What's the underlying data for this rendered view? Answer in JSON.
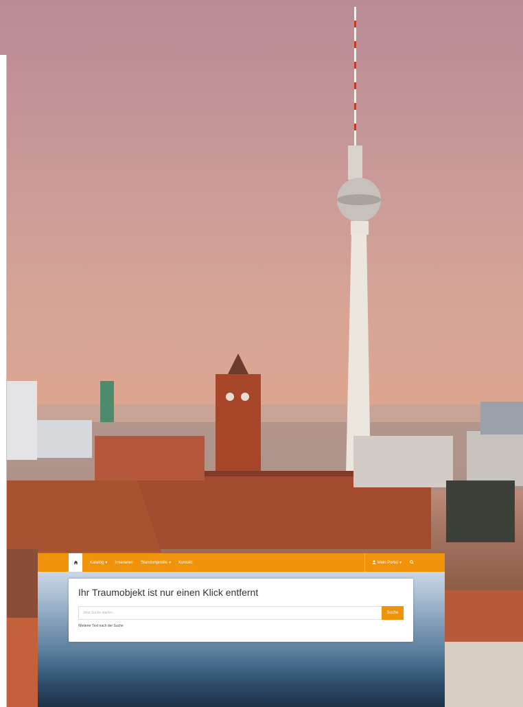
{
  "site": {
    "nav": {
      "home_icon": "home-icon",
      "items": [
        {
          "label": "Katalog",
          "has_caret": true
        },
        {
          "label": "Inserieren",
          "has_caret": false
        },
        {
          "label": "Standortprofile",
          "has_caret": true
        },
        {
          "label": "Kontakt",
          "has_caret": false
        }
      ],
      "portal_label": "Mein Portal",
      "portal_icon": "user-icon",
      "search_icon": "search-icon",
      "caret": "▾"
    },
    "hero": {
      "title": "Ihr Traumobjekt ist nur einen Klick entfernt",
      "search_placeholder": "Jetzt Suche starten...",
      "search_button": "Suche",
      "subtext": "Weiterer Text nach der Suche"
    },
    "colors": {
      "accent": "#f0920a",
      "card": "#ffffff"
    }
  }
}
